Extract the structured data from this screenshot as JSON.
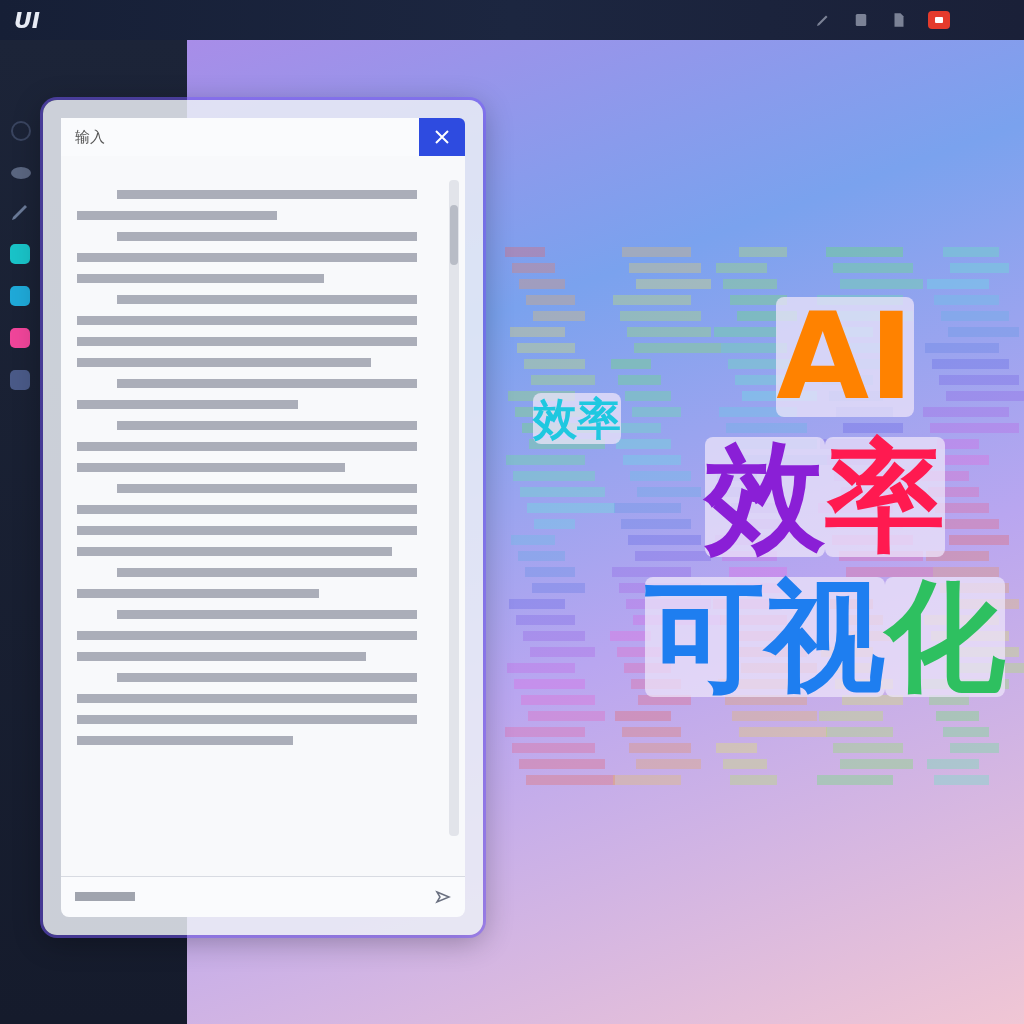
{
  "top_bar": {
    "logo": "UI",
    "icons": [
      {
        "kind": "pen"
      },
      {
        "kind": "note"
      },
      {
        "kind": "doc"
      },
      {
        "kind": "record",
        "selected": true
      }
    ]
  },
  "sidebar": {
    "items": [
      {
        "kind": "ring",
        "color": "#3a4560"
      },
      {
        "kind": "cloud",
        "color": "#5a6680"
      },
      {
        "kind": "pen",
        "color": "#6a7a98"
      },
      {
        "kind": "tile",
        "color": "#19c3c8"
      },
      {
        "kind": "tile",
        "color": "#1fa9d8"
      },
      {
        "kind": "tile",
        "color": "#f0459a"
      },
      {
        "kind": "tile",
        "color": "#4a5a88"
      }
    ]
  },
  "dialog": {
    "title": "输入"
  },
  "word_cloud": {
    "lines": [
      [
        {
          "text": "AI",
          "color": "#ff8200"
        }
      ],
      [
        {
          "text": "效",
          "color": "#8a1fd6"
        },
        {
          "text": "率",
          "color": "#ff1a50"
        }
      ],
      [
        {
          "text": "可视",
          "color": "#1e7ef0"
        },
        {
          "text": "化",
          "color": "#2ec060"
        }
      ]
    ],
    "minor": [
      {
        "text": "效率",
        "color": "#1fc8e0"
      }
    ]
  }
}
